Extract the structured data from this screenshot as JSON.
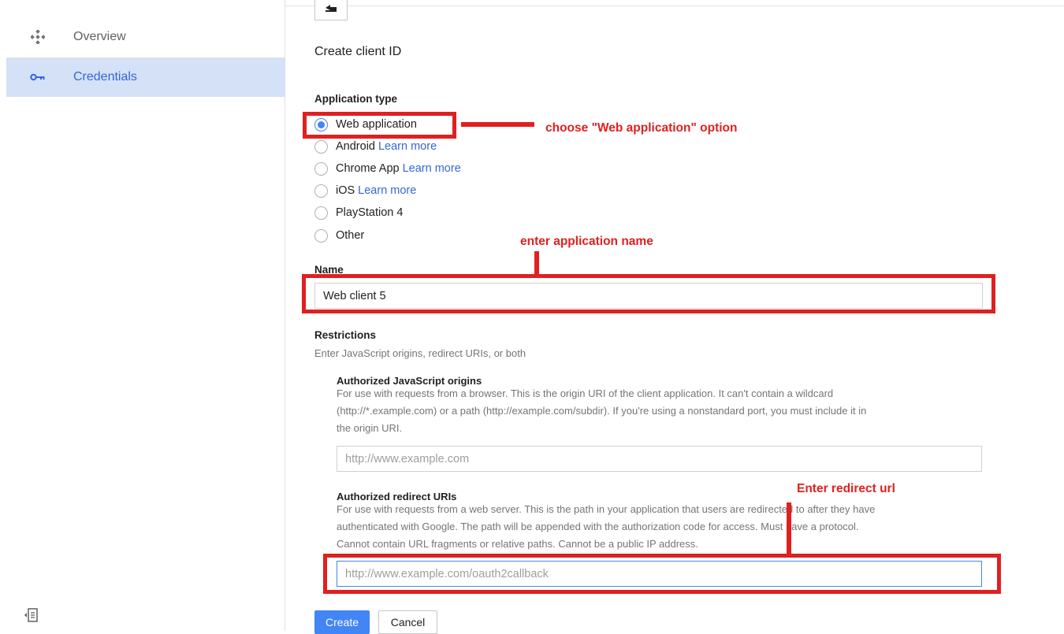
{
  "sidebar": {
    "items": [
      {
        "label": "Overview",
        "icon": "overview-icon"
      },
      {
        "label": "Credentials",
        "icon": "key-icon",
        "active": true
      }
    ],
    "collapse_icon": "collapse-sidebar-icon"
  },
  "main": {
    "back_icon": "back-arrow-icon",
    "title": "Create client ID",
    "application_type": {
      "label": "Application type",
      "options": [
        {
          "label": "Web application",
          "link": "",
          "selected": true
        },
        {
          "label": "Android",
          "link": "Learn more"
        },
        {
          "label": "Chrome App",
          "link": "Learn more"
        },
        {
          "label": "iOS",
          "link": "Learn more"
        },
        {
          "label": "PlayStation 4",
          "link": ""
        },
        {
          "label": "Other",
          "link": ""
        }
      ]
    },
    "name": {
      "label": "Name",
      "value": "Web client 5"
    },
    "restrictions": {
      "label": "Restrictions",
      "description": "Enter JavaScript origins, redirect URIs, or both",
      "js_origins": {
        "label": "Authorized JavaScript origins",
        "help_lines": [
          "For use with requests from a browser. This is the origin URI of the client application. It can't contain a wildcard",
          "(http://*.example.com) or a path (http://example.com/subdir). If you're using a nonstandard port, you must include it in",
          "the origin URI."
        ],
        "placeholder": "http://www.example.com"
      },
      "redirect_uris": {
        "label": "Authorized redirect URIs",
        "help_lines": [
          "For use with requests from a web server. This is the path in your application that users are redirected to after they have",
          "authenticated with Google. The path will be appended with the authorization code for access. Must have a protocol.",
          "Cannot contain URL fragments or relative paths. Cannot be a public IP address."
        ],
        "placeholder": "http://www.example.com/oauth2callback"
      }
    },
    "buttons": {
      "create": "Create",
      "cancel": "Cancel"
    }
  },
  "annotations": {
    "web_app": "choose \"Web application\" option",
    "app_name": "enter application name",
    "redirect": "Enter redirect url"
  },
  "colors": {
    "accent": "#4285f4",
    "link": "#3367d6",
    "active_nav_bg": "#d4e1f7",
    "annotation_red": "#e02020"
  }
}
